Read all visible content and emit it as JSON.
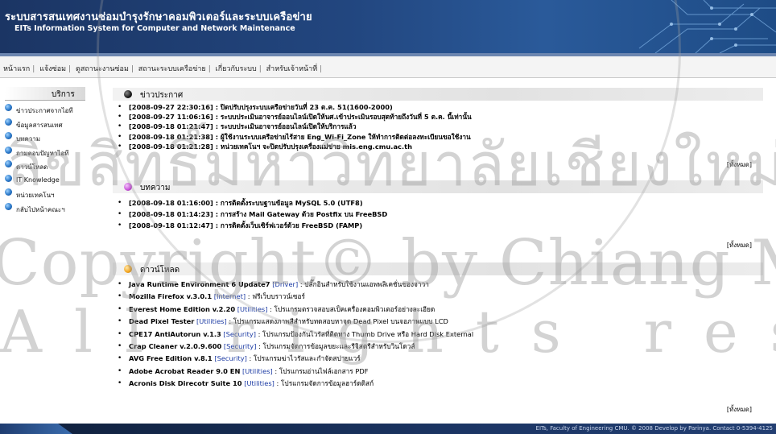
{
  "header": {
    "title_th": "ระบบสารสนเทศงานซ่อมบำรุงรักษาคอมพิวเตอร์และระบบเครือข่าย",
    "title_en": "EITs Information System for Computer and Network Maintenance"
  },
  "menu": [
    "หน้าแรก",
    "แจ้งซ่อม",
    "ดูสถานะงานซ่อม",
    "สถานะระบบเครือข่าย",
    "เกี่ยวกับระบบ",
    "สำหรับเจ้าหน้าที่"
  ],
  "sidebar": {
    "title": "บริการ",
    "items": [
      "ข่าวประกาศจากไอที",
      "ข้อมูลสารสนเทศ",
      "บทความ",
      "ถามตอบปัญหาไอที",
      "ดาวน์โหลด",
      "IT Knowledge",
      "หน่วยเทคโนฯ",
      "กลับไปหน้าคณะฯ"
    ]
  },
  "news": {
    "title": "ข่าวประกาศ",
    "items": [
      {
        "ts": "[2008-09-27 22:30:16]",
        "text": " : ปิดปรับปรุงระบบเครือข่ายวันที่ 23 ต.ค. 51(1600-2000)"
      },
      {
        "ts": "[2008-09-27 11:06:16]",
        "text": " : ระบบประเมินอาจารย์ออนไลน์เปิดให้นศ.เข้าประเมินรอบสุดท้ายถึงวันที่ 5 ต.ค. นี้เท่านั้น"
      },
      {
        "ts": "[2008-09-18 01:21:47]",
        "text": " : ระบบประเมินอาจารย์ออนไลน์เปิดให้บริการแล้ว"
      },
      {
        "ts": "[2008-09-18 01:21:38]",
        "text": " : ผู้ใช้งานระบบเครือข่ายไร้สาย Eng_Wi-Fi_Zone ให้ทำการติดต่อลงทะเบียนขอใช้งาน"
      },
      {
        "ts": "[2008-09-18 01:21:28]",
        "text": " : หน่วยเทคโนฯ จะปิดปรับปรุงเครื่องแม่ข่าย mis.eng.cmu.ac.th"
      }
    ],
    "more": "[ทั้งหมด]"
  },
  "articles": {
    "title": "บทความ",
    "items": [
      {
        "ts": "[2008-09-18 01:16:00]",
        "text": " : การติดตั้งระบบฐานข้อมูล MySQL 5.0 (UTF8)"
      },
      {
        "ts": "[2008-09-18 01:14:23]",
        "text": " : การสร้าง Mail Gateway ด้วย Postfix บน FreeBSD"
      },
      {
        "ts": "[2008-09-18 01:12:47]",
        "text": " : การติดตั้งเว็บเซิร์ฟเวอร์ด้วย FreeBSD (FAMP)"
      }
    ],
    "more": "[ทั้งหมด]"
  },
  "downloads": {
    "title": "ดาวน์โหลด",
    "items": [
      {
        "name": "Java Runtime Environment 6 Update7",
        "cat": "[Driver]",
        "desc": " : ปลั๊กอินสำหรับใช้งานแอพพลิเคชั่นของจาวา"
      },
      {
        "name": "Mozilla Firefox v.3.0.1",
        "cat": "[Internet]",
        "desc": " : ฟรีเว็บบราวน์เซอร์"
      },
      {
        "name": "Everest Home Edition v.2.20",
        "cat": "[Utilities]",
        "desc": " : โปรแกรมตรวจสอบสเป็คเครื่องคอมพิวเตอร์อย่างละเอียด"
      },
      {
        "name": "Dead Pixel Tester",
        "cat": "[Utilities]",
        "desc": " : โปรแกรมแสดงภาพสีสำหรับทดสอบหาจุด Dead Pixel บนจอภาพแบบ LCD"
      },
      {
        "name": "CPE17 AntiAutorun v.1.3",
        "cat": "[Security]",
        "desc": " : โปรแกรมป้องกันไวรัสที่ติดทาง Thumb Drive หรือ Hard Disk External"
      },
      {
        "name": "Crap Cleaner v.2.0.9.600",
        "cat": "[Security]",
        "desc": " : โปรแกรมจัดการข้อมูลขยะและรีจิสตรีสำหรับวินโดวส์"
      },
      {
        "name": "AVG Free Edition v.8.1",
        "cat": "[Security]",
        "desc": " : โปรแกรมฆ่าไวรัสและกำจัดสปายแวร์"
      },
      {
        "name": "Adobe Acrobat Reader 9.0 EN",
        "cat": "[Utilities]",
        "desc": " : โปรแกรมอ่านไฟล์เอกสาร PDF"
      },
      {
        "name": "Acronis Disk Direcotr Suite 10",
        "cat": "[Utilities]",
        "desc": " : โปรแกรมจัดการข้อมูลฮาร์ดดิสก์"
      }
    ],
    "more": "[ทั้งหมด]"
  },
  "footer": {
    "text": "EITs, Faculty of Engineering CMU. © 2008 Develop by Parinya. Contact 0-5394-4125"
  },
  "watermark": {
    "line1": "ลิขสิทธิ์มหาวิทยาลัยเชียงใหม่",
    "line2": "Copyright© by Chiang Mai University",
    "line3": "All rights reserved"
  },
  "colors": {
    "header_bg": "#1b3564",
    "news_bullet": "#1a1a1a",
    "articles_bullet": "#c64fd6",
    "downloads_bullet": "#f2a31b",
    "side_bullet": "#2a78c8"
  }
}
